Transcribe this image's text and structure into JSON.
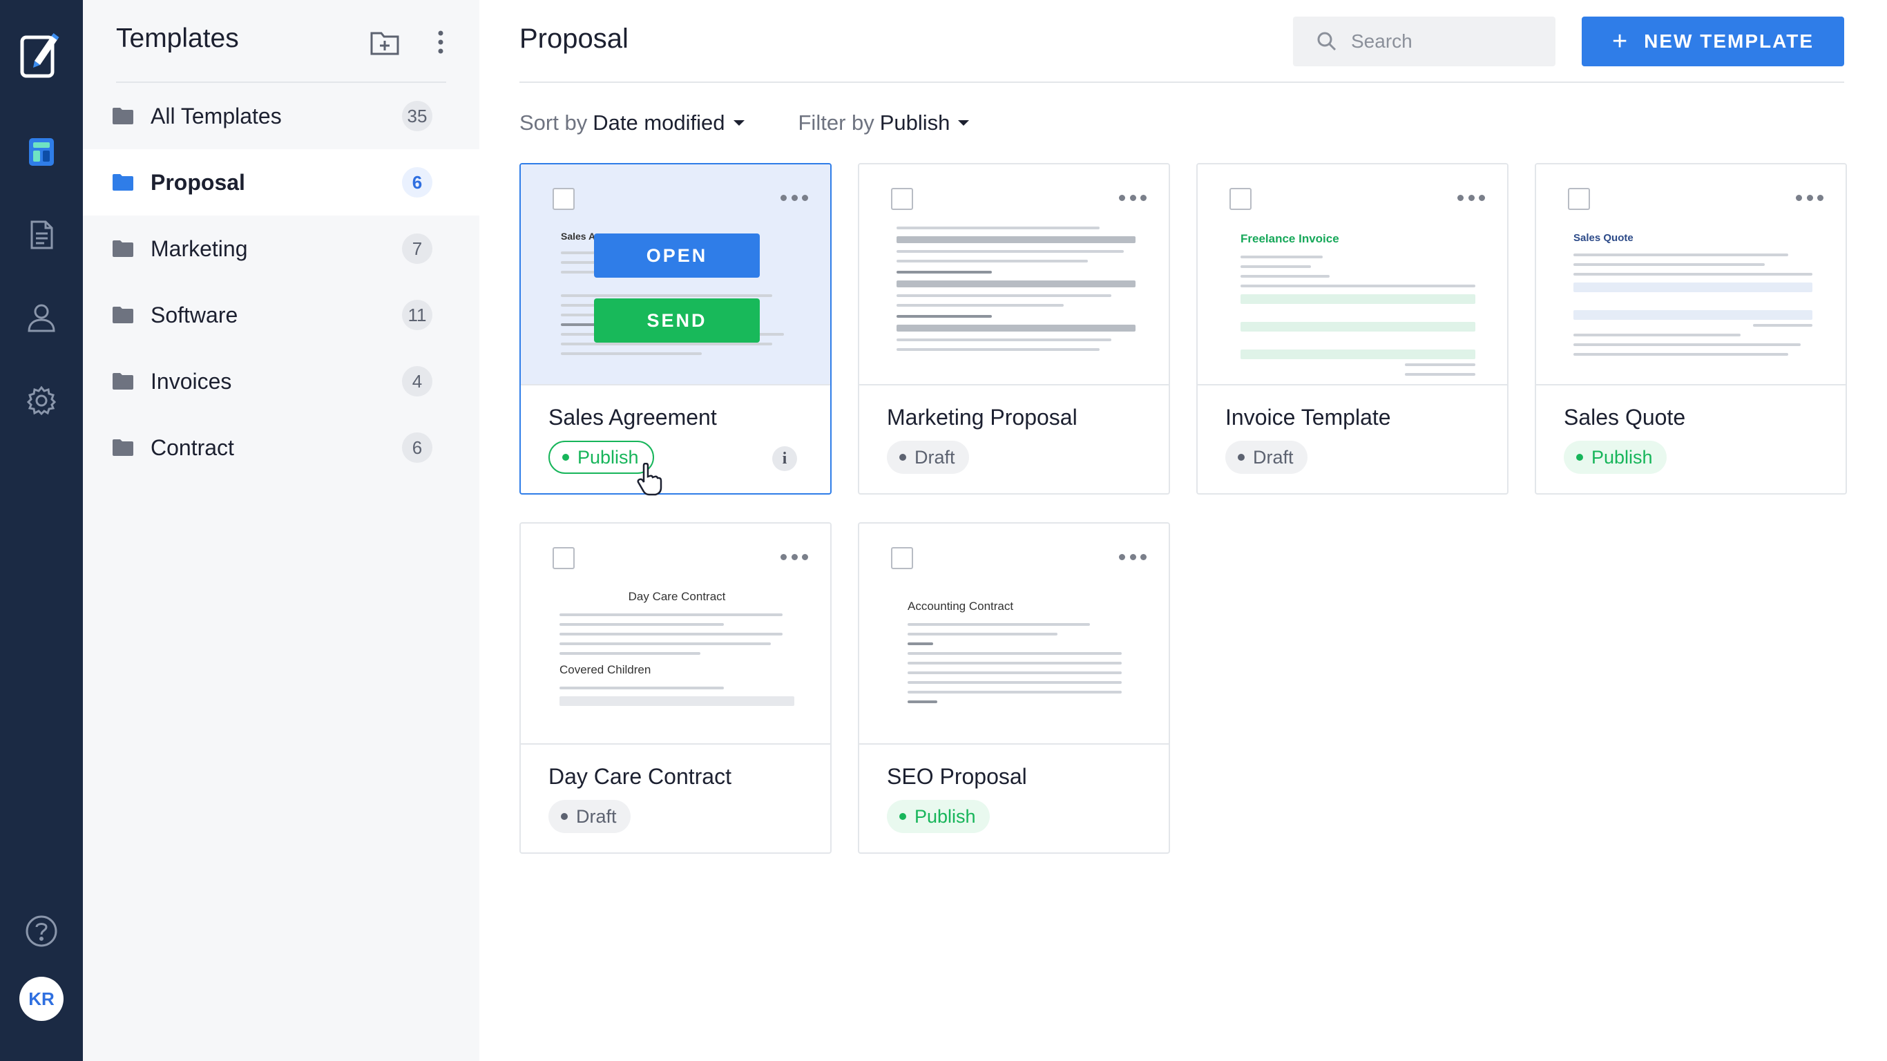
{
  "rail": {
    "avatar_initials": "KR",
    "icons": [
      "app-logo-icon",
      "templates-icon",
      "documents-icon",
      "contacts-icon",
      "settings-icon",
      "help-icon"
    ]
  },
  "sidebar": {
    "title": "Templates",
    "folders": [
      {
        "label": "All Templates",
        "count": "35"
      },
      {
        "label": "Proposal",
        "count": "6"
      },
      {
        "label": "Marketing",
        "count": "7"
      },
      {
        "label": "Software",
        "count": "11"
      },
      {
        "label": "Invoices",
        "count": "4"
      },
      {
        "label": "Contract",
        "count": "6"
      }
    ],
    "active_index": 1
  },
  "header": {
    "title": "Proposal",
    "search_placeholder": "Search",
    "new_button": "NEW TEMPLATE"
  },
  "toolbar": {
    "sort_prefix": "Sort by",
    "sort_value": "Date modified",
    "filter_prefix": "Filter by",
    "filter_value": "Publish"
  },
  "hover_actions": {
    "open": "OPEN",
    "send": "SEND"
  },
  "cards": [
    {
      "name": "Sales Agreement",
      "status": "Publish",
      "thumb_title": "Sales A"
    },
    {
      "name": "Marketing Proposal",
      "status": "Draft"
    },
    {
      "name": "Invoice Template",
      "status": "Draft",
      "thumb_title": "Freelance Invoice"
    },
    {
      "name": "Sales Quote",
      "status": "Publish",
      "thumb_title": "Sales Quote"
    },
    {
      "name": "Day Care Contract",
      "status": "Draft",
      "thumb_title": "Day Care Contract",
      "thumb_subtitle": "Covered Children"
    },
    {
      "name": "SEO Proposal",
      "status": "Publish",
      "thumb_title": "Accounting Contract"
    }
  ],
  "colors": {
    "rail_bg": "#1b2a44",
    "accent_blue": "#2f7de8",
    "publish_green": "#17b55a",
    "send_green": "#18b95a"
  }
}
